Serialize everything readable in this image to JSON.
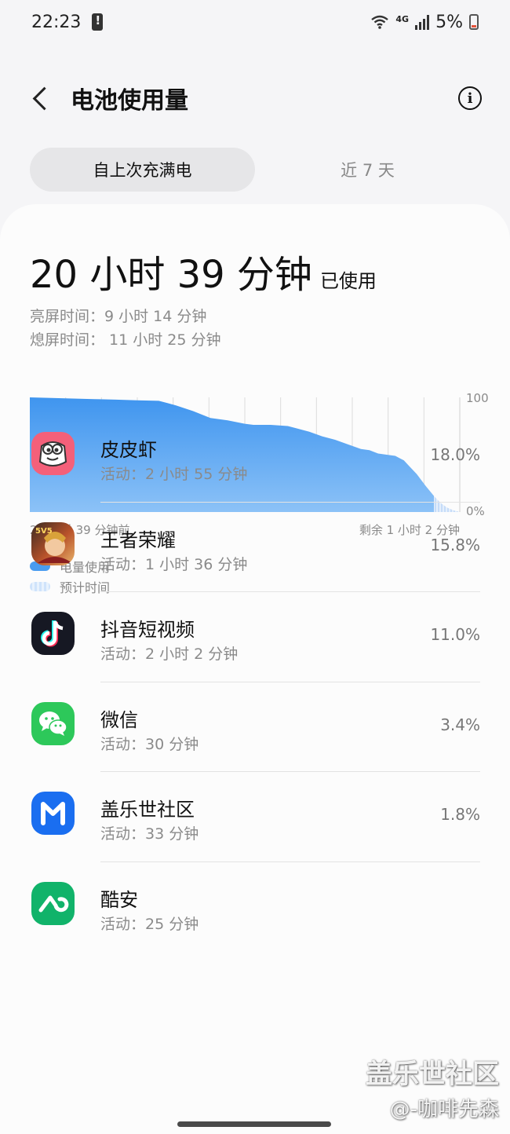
{
  "status_bar": {
    "time": "22:23",
    "battery_percent": "5%",
    "network": "4G"
  },
  "header": {
    "title": "电池使用量"
  },
  "tabs": [
    {
      "label": "自上次充满电",
      "active": true
    },
    {
      "label": "近 7 天",
      "active": false
    }
  ],
  "summary": {
    "total": "20 小时 39 分钟",
    "suffix": "已使用",
    "screen_on": "亮屏时间：9 小时 14 分钟",
    "screen_off": "熄屏时间： 11 小时 25 分钟"
  },
  "chart_data": {
    "type": "area",
    "x_start_label": "20 小时 39 分钟前",
    "x_end_label": "剩余 1 小时 2 分钟",
    "y_tick_labels": [
      "100",
      "0%"
    ],
    "ylim": [
      0,
      100
    ],
    "grid": true,
    "x": [
      0,
      0.05,
      0.1,
      0.15,
      0.2,
      0.25,
      0.3,
      0.32,
      0.34,
      0.38,
      0.42,
      0.46,
      0.5,
      0.52,
      0.56,
      0.6,
      0.62,
      0.65,
      0.68,
      0.71,
      0.74,
      0.77,
      0.79,
      0.81,
      0.83,
      0.85,
      0.87,
      0.88,
      0.9,
      0.92,
      0.94,
      0.955,
      0.97,
      0.985,
      1.0
    ],
    "y": [
      100,
      99.5,
      99,
      98.5,
      98,
      97.5,
      97,
      95,
      93,
      88,
      82,
      80,
      77,
      76,
      76,
      75,
      73,
      70,
      66,
      63,
      59,
      55,
      54,
      51,
      50,
      49,
      45,
      41,
      33,
      23,
      14,
      8,
      4,
      1.5,
      0
    ],
    "projection_after": 0.94,
    "color": "#4a9cf0"
  },
  "legend": [
    {
      "label": "电量使用",
      "style": "solid"
    },
    {
      "label": "预计时间",
      "style": "striped"
    }
  ],
  "apps": [
    {
      "name": "皮皮虾",
      "activity": "活动：2 小时 55 分钟",
      "percent": "18.0%",
      "icon": "pipixia-icon"
    },
    {
      "name": "王者荣耀",
      "activity": "活动：1 小时 36 分钟",
      "percent": "15.8%",
      "icon": "honor-of-kings-icon"
    },
    {
      "name": "抖音短视频",
      "activity": "活动：2 小时 2 分钟",
      "percent": "11.0%",
      "icon": "douyin-icon"
    },
    {
      "name": "微信",
      "activity": "活动：30 分钟",
      "percent": "3.4%",
      "icon": "wechat-icon"
    },
    {
      "name": "盖乐世社区",
      "activity": "活动：33 分钟",
      "percent": "1.8%",
      "icon": "galaxy-community-icon"
    },
    {
      "name": "酷安",
      "activity": "活动：25 分钟",
      "percent": "",
      "icon": "coolapk-icon"
    }
  ],
  "watermark": {
    "line1": "盖乐世社区",
    "line2": "@-咖啡先森"
  }
}
